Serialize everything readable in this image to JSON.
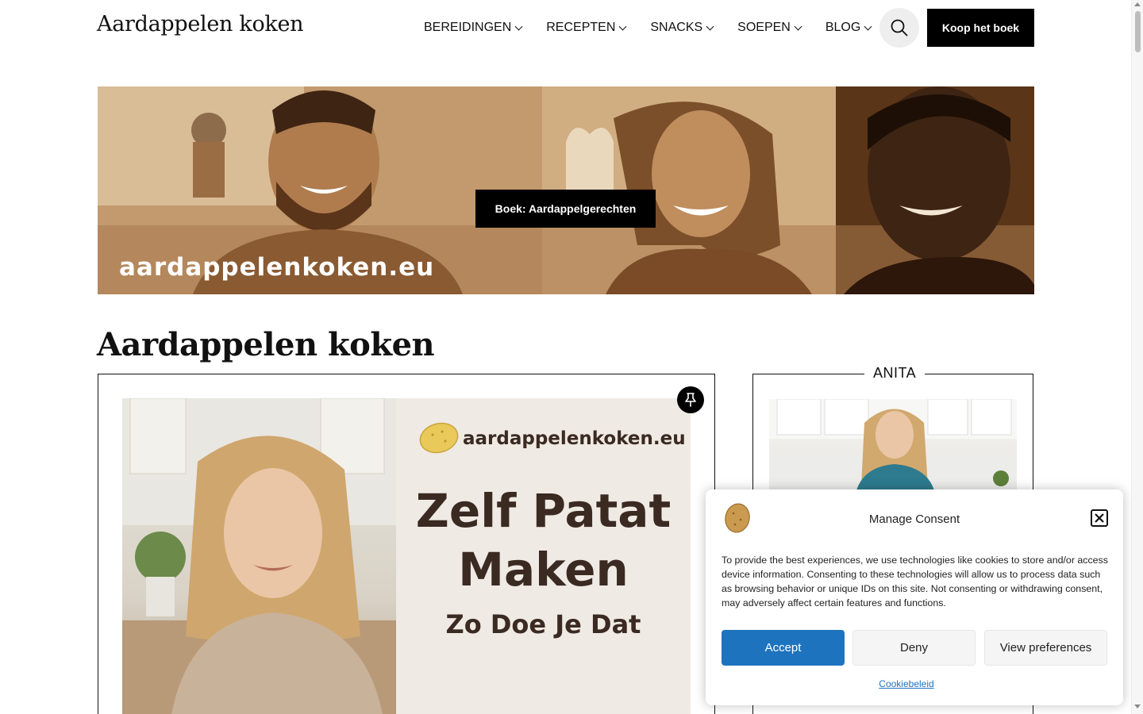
{
  "header": {
    "site_title": "Aardappelen koken",
    "nav": [
      {
        "label": "BEREIDINGEN",
        "icon": "chevron-down-icon"
      },
      {
        "label": "RECEPTEN",
        "icon": "chevron-down-icon"
      },
      {
        "label": "SNACKS",
        "icon": "chevron-down-icon"
      },
      {
        "label": "SOEPEN",
        "icon": "chevron-down-icon"
      },
      {
        "label": "BLOG",
        "icon": "chevron-down-icon"
      }
    ],
    "search_icon": "search-icon",
    "buy_button": "Koop het boek"
  },
  "hero": {
    "button_label": "Boek: Aardappelgerechten",
    "watermark": "aardappelenkoken.eu"
  },
  "main": {
    "page_heading": "Aardappelen koken",
    "featured_post": {
      "image_logo_text": "aardappelenkoken.eu",
      "image_title_line1": "Zelf Patat",
      "image_title_line2": "Maken",
      "image_subtitle": "Zo Doe Je Dat",
      "pin_icon": "pin-icon"
    }
  },
  "sidebar": {
    "widget_title": "ANITA"
  },
  "consent": {
    "title": "Manage Consent",
    "text": "To provide the best experiences, we use technologies like cookies to store and/or access device information. Consenting to these technologies will allow us to process data such as browsing behavior or unique IDs on this site. Not consenting or withdrawing consent, may adversely affect certain features and functions.",
    "accept": "Accept",
    "deny": "Deny",
    "preferences": "View preferences",
    "policy_link": "Cookiebeleid",
    "accent_color": "#1e73be"
  }
}
